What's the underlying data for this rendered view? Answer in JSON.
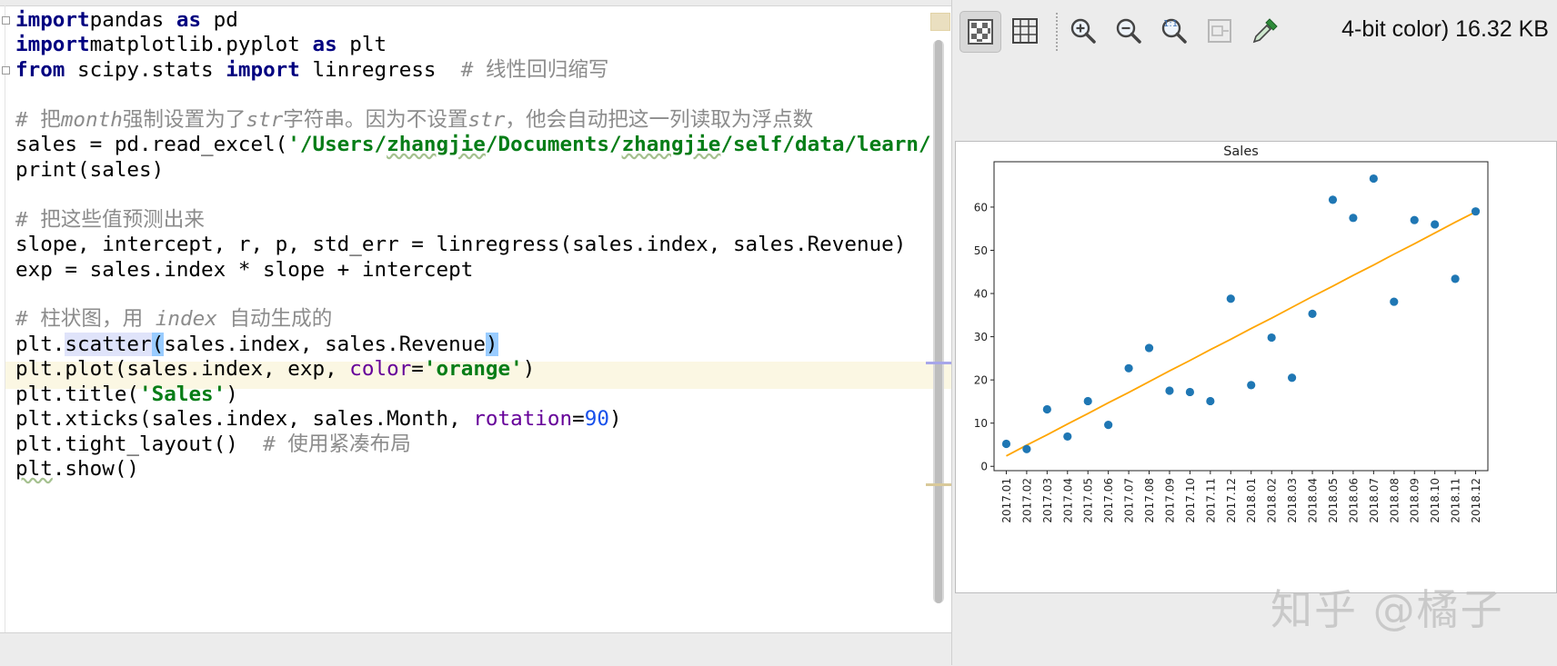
{
  "editor": {
    "lines": [
      [
        [
          "kw",
          "import"
        ],
        [
          "",
          "pandas "
        ],
        [
          "kw",
          "as"
        ],
        [
          "",
          " pd"
        ]
      ],
      [
        [
          "kw",
          "import"
        ],
        [
          "",
          "matplotlib.pyplot "
        ],
        [
          "kw",
          "as"
        ],
        [
          "",
          " plt"
        ]
      ],
      [
        [
          "kw",
          "from"
        ],
        [
          "",
          " scipy.stats "
        ],
        [
          "kw",
          "import"
        ],
        [
          "",
          " linregress  "
        ],
        [
          "cmt",
          "# 线性回归缩写"
        ]
      ],
      [],
      [
        [
          "cmt",
          "# 把"
        ],
        [
          "cmt-i",
          "month"
        ],
        [
          "cmt",
          "强制设置为了"
        ],
        [
          "cmt-i",
          "str"
        ],
        [
          "cmt",
          "字符串。因为不设置"
        ],
        [
          "cmt-i",
          "str"
        ],
        [
          "cmt",
          "，他会自动把这一列读取为浮点数"
        ]
      ],
      [
        [
          "",
          "sales = pd.read_excel("
        ],
        [
          "str",
          "'/Users/"
        ],
        [
          "str squiggle",
          "zhangjie"
        ],
        [
          "str",
          "/Documents/"
        ],
        [
          "str squiggle",
          "zhangjie"
        ],
        [
          "str",
          "/self/data/learn/"
        ]
      ],
      [
        [
          "",
          "print(sales)"
        ]
      ],
      [],
      [
        [
          "cmt",
          "# 把这些值预测出来"
        ]
      ],
      [
        [
          "",
          "slope, intercept, r, p, std_err = linregress(sales.index, sales.Revenue)"
        ]
      ],
      [
        [
          "",
          "exp = sales.index * slope + intercept"
        ]
      ],
      [],
      [
        [
          "cmt",
          "# 柱状图，用 "
        ],
        [
          "cmt-i",
          "index"
        ],
        [
          "cmt",
          " 自动生成的"
        ]
      ],
      [
        [
          "",
          "plt."
        ],
        [
          "hl-sel",
          "scatter"
        ],
        [
          "hl-paren",
          "("
        ],
        [
          "",
          "sales.index, sales.Revenue"
        ],
        [
          "hl-paren",
          ")"
        ]
      ],
      [
        [
          "",
          "plt.plot(sales.index, exp, "
        ],
        [
          "kwarg",
          "color"
        ],
        [
          "",
          "="
        ],
        [
          "str",
          "'orange'"
        ],
        [
          "",
          ")"
        ]
      ],
      [
        [
          "",
          "plt.title("
        ],
        [
          "str",
          "'Sales'"
        ],
        [
          "",
          ")"
        ]
      ],
      [
        [
          "",
          "plt.xticks(sales.index, sales.Month, "
        ],
        [
          "kwarg",
          "rotation"
        ],
        [
          "",
          "="
        ],
        [
          "num",
          "90"
        ],
        [
          "",
          ")"
        ]
      ],
      [
        [
          "",
          "plt.tight_layout()  "
        ],
        [
          "cmt",
          "# 使用紧凑布局"
        ]
      ],
      [
        [
          "squiggle",
          "plt"
        ],
        [
          "",
          ".show()"
        ]
      ]
    ]
  },
  "viewer": {
    "tools": [
      {
        "name": "checkerboard-toggle-icon"
      },
      {
        "name": "grid-toggle-icon"
      },
      {
        "name": "zoom-in-icon"
      },
      {
        "name": "zoom-out-icon"
      },
      {
        "name": "actual-size-icon",
        "label": "1:1"
      },
      {
        "name": "fit-to-window-icon"
      },
      {
        "name": "color-picker-icon"
      }
    ],
    "image_info": "4-bit color) 16.32 KB",
    "watermark": "知乎 @橘子"
  },
  "colors": {
    "scatter": "#1f77b4",
    "fit_line": "#ffa500",
    "keyword": "#000080",
    "string": "#067d17",
    "comment": "#8c8c8c"
  },
  "chart_data": {
    "type": "scatter",
    "title": "Sales",
    "xlabel": "",
    "ylabel": "",
    "categories": [
      "2017.01",
      "2017.02",
      "2017.03",
      "2017.04",
      "2017.05",
      "2017.06",
      "2017.07",
      "2017.08",
      "2017.09",
      "2017.10",
      "2017.11",
      "2017.12",
      "2018.01",
      "2018.02",
      "2018.03",
      "2018.04",
      "2018.05",
      "2018.06",
      "2018.07",
      "2018.08",
      "2018.09",
      "2018.10",
      "2018.11",
      "2018.12"
    ],
    "x": [
      0,
      1,
      2,
      3,
      4,
      5,
      6,
      7,
      8,
      9,
      10,
      11,
      12,
      13,
      14,
      15,
      16,
      17,
      18,
      19,
      20,
      21,
      22,
      23
    ],
    "series": [
      {
        "kind": "scatter",
        "color": "#1f77b4",
        "values": [
          5.2,
          4.0,
          13.2,
          6.9,
          15.1,
          9.6,
          22.7,
          27.4,
          17.5,
          17.2,
          15.1,
          38.8,
          18.8,
          29.8,
          20.5,
          35.3,
          61.7,
          57.5,
          66.6,
          38.1,
          57.0,
          56.0,
          43.4,
          59.0
        ]
      },
      {
        "kind": "line",
        "color": "#ffa500",
        "values": [
          2.4,
          4.9,
          7.3,
          9.8,
          12.2,
          14.7,
          17.1,
          19.6,
          22.1,
          24.5,
          27.0,
          29.4,
          31.9,
          34.3,
          36.8,
          39.3,
          41.7,
          44.2,
          46.6,
          49.1,
          51.5,
          54.0,
          56.5,
          58.9
        ]
      }
    ],
    "yticks": [
      0,
      10,
      20,
      30,
      40,
      50,
      60
    ],
    "ylim": [
      -1,
      70.5
    ],
    "xlim": [
      -0.6,
      23.6
    ],
    "grid": false,
    "legend": "none"
  }
}
